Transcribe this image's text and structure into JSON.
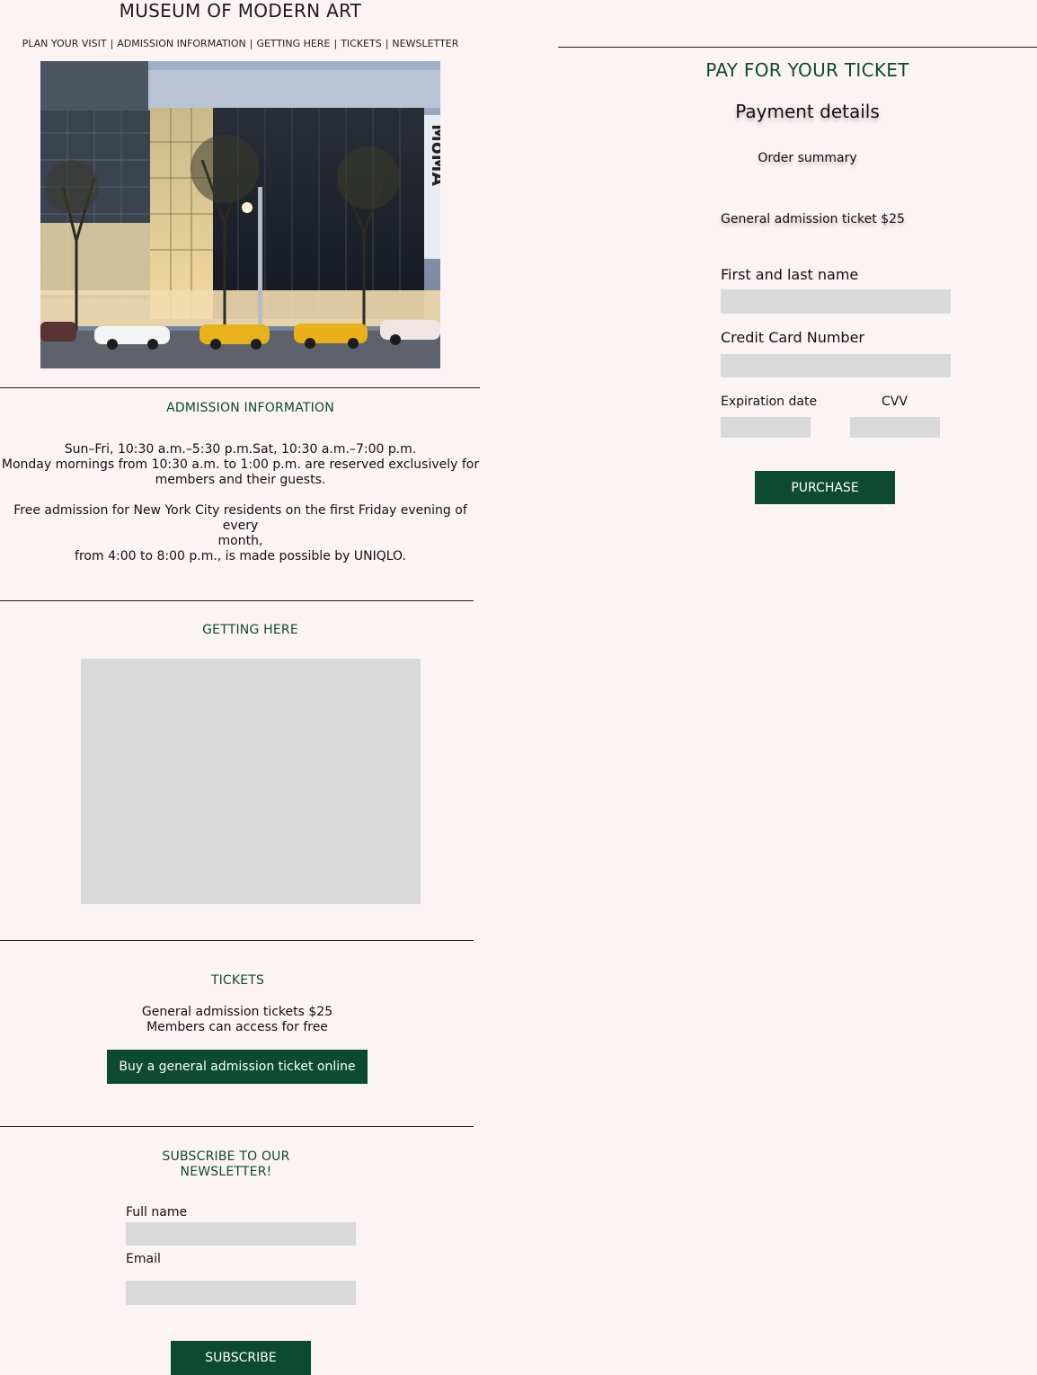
{
  "header": {
    "title": "MUSEUM OF MODERN ART",
    "nav": [
      "PLAN YOUR VISIT",
      "ADMISSION INFORMATION",
      "GETTING HERE",
      "TICKETS",
      "NEWSLETTER"
    ],
    "nav_separator": "|"
  },
  "hero": {
    "sign_text": "MoMA"
  },
  "admission": {
    "heading": "ADMISSION INFORMATION",
    "hours_line1": "Sun–Fri, 10:30 a.m.–5:30 p.m.Sat, 10:30 a.m.–7:00 p.m.",
    "hours_line2": "Monday mornings from 10:30 a.m. to 1:00 p.m. are reserved exclusively for",
    "hours_line3": "members and their guests.",
    "free_line1": "Free admission for New York City residents on the first Friday evening of every",
    "free_line2": "month,",
    "free_line3": "from 4:00 to 8:00 p.m., is made possible by UNIQLO."
  },
  "getting_here": {
    "heading": "GETTING HERE"
  },
  "tickets": {
    "heading": "TICKETS",
    "line1": "General admission tickets $25",
    "line2": "Members can access for free",
    "buy_button": "Buy a general admission ticket online"
  },
  "newsletter": {
    "heading_line1": "SUBSCRIBE TO OUR",
    "heading_line2": "NEWSLETTER!",
    "full_name_label": "Full name",
    "email_label": "Email",
    "subscribe_button": "SUBSCRIBE"
  },
  "payment": {
    "heading": "PAY FOR YOUR TICKET",
    "subheading": "Payment details",
    "order_summary": "Order summary",
    "order_item": "General admission ticket $25",
    "name_label": "First and last name",
    "card_label": "Credit Card Number",
    "expiry_label": "Expiration date",
    "cvv_label": "CVV",
    "purchase_button": "PURCHASE"
  },
  "colors": {
    "background": "#fcf4f4",
    "accent": "#0c4a31",
    "field": "#d9d9d9"
  }
}
